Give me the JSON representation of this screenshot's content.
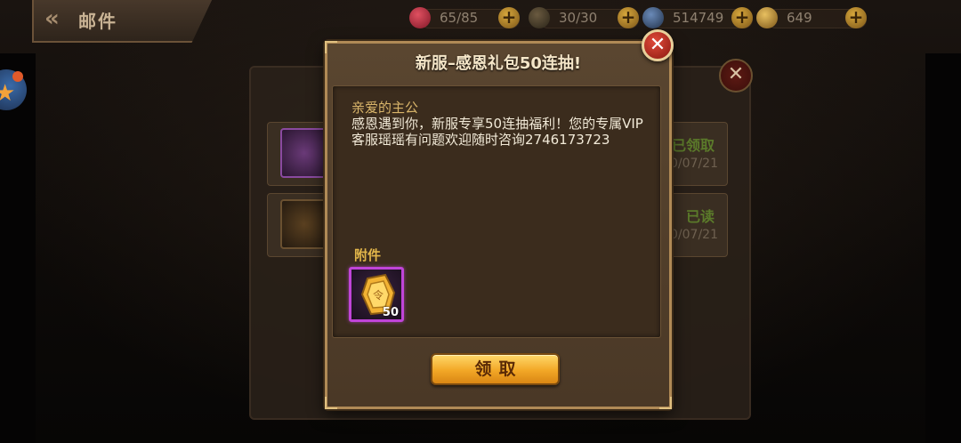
{
  "header": {
    "back_icon": "double-chevron-left-icon",
    "title": "邮件",
    "resources": [
      {
        "icon": "heart-icon",
        "value": "65/85",
        "color": "#c0303a"
      },
      {
        "icon": "lightning-icon",
        "value": "30/30",
        "color": "#8a7a5a"
      },
      {
        "icon": "coin-icon",
        "value": "514749",
        "color": "#4a6a9a"
      },
      {
        "icon": "gold-ingot-icon",
        "value": "649",
        "color": "#c89a3a"
      }
    ]
  },
  "mail_list": {
    "items": [
      {
        "status": "已领取",
        "date": "0/07/21"
      },
      {
        "status": "已读",
        "date": "0/07/21"
      }
    ]
  },
  "dialog": {
    "title": "新服–感恩礼包50连抽!",
    "greeting": "亲爱的主公",
    "body": "感恩遇到你，新服专享50连抽福利！您的专属VIP客服瑶瑶有问题欢迎随时咨询2746173723",
    "attachment_label": "附件",
    "attachment": {
      "icon": "gold-token-icon",
      "quantity": "50"
    },
    "claim_label": "领取",
    "close_icon": "close-icon"
  },
  "colors": {
    "accent_gold": "#f2a726",
    "title_text": "#f5e6c8",
    "item_border": "#c044d8"
  }
}
